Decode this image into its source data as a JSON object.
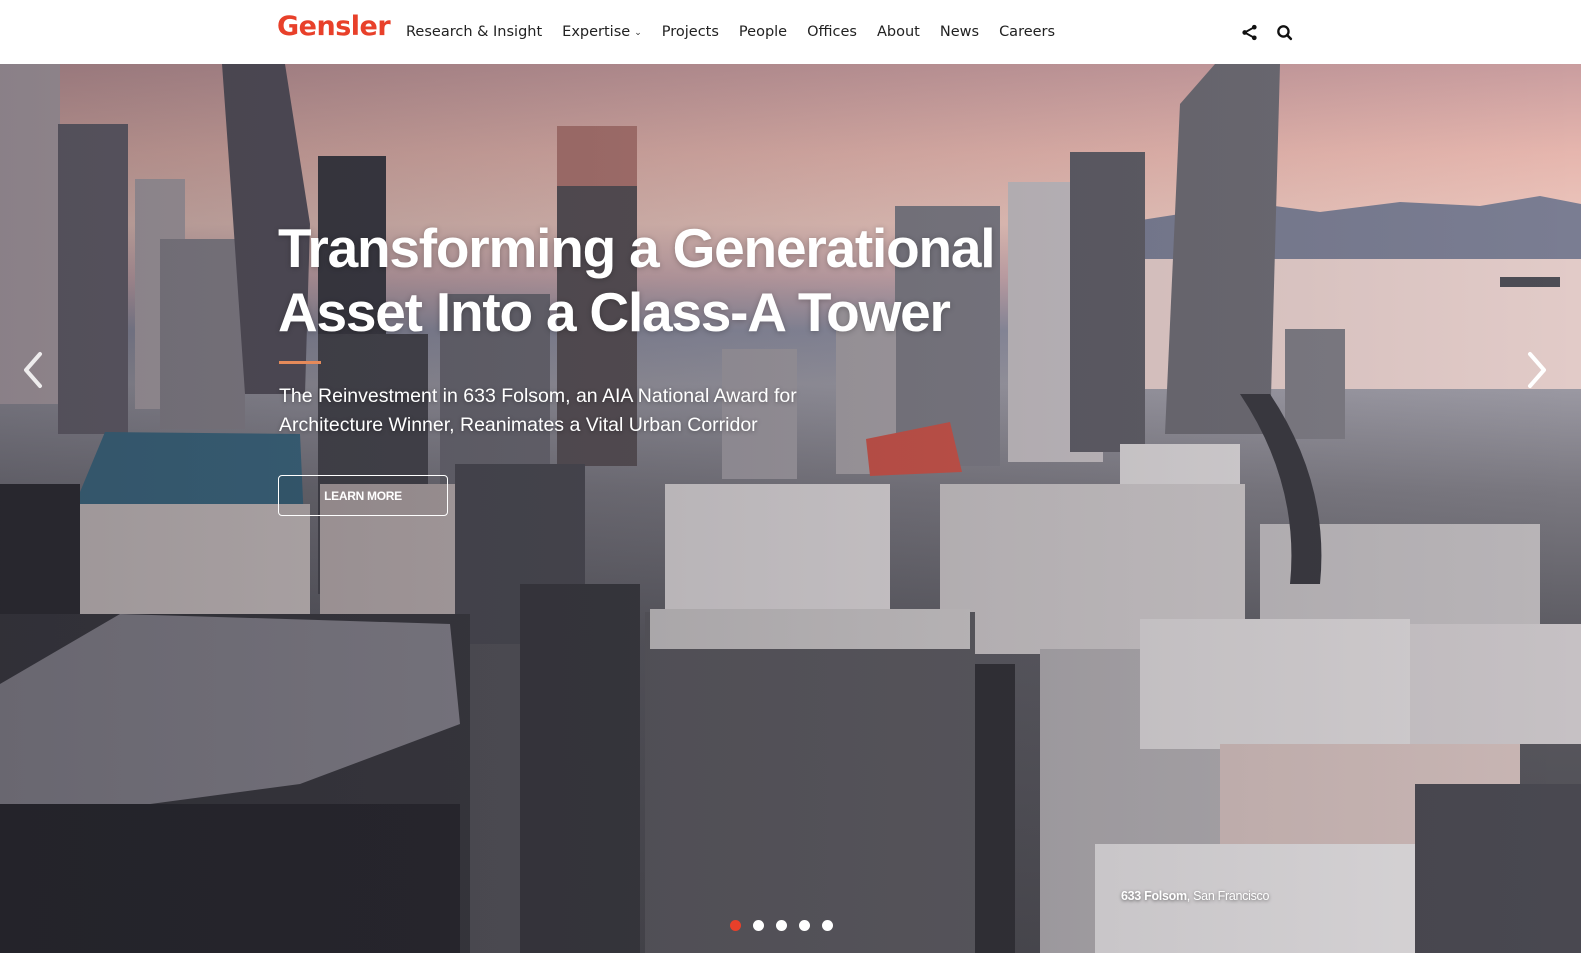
{
  "header": {
    "logo": "Gensler",
    "nav": [
      {
        "label": "Research & Insight",
        "has_dropdown": false
      },
      {
        "label": "Expertise",
        "has_dropdown": true
      },
      {
        "label": "Projects",
        "has_dropdown": false
      },
      {
        "label": "People",
        "has_dropdown": false
      },
      {
        "label": "Offices",
        "has_dropdown": false
      },
      {
        "label": "About",
        "has_dropdown": false
      },
      {
        "label": "News",
        "has_dropdown": false
      },
      {
        "label": "Careers",
        "has_dropdown": false
      }
    ],
    "icons": [
      "share-icon",
      "search-icon"
    ]
  },
  "hero": {
    "title_line1": "Transforming a Generational",
    "title_line2": "Asset Into a Class-A Tower",
    "subtitle": "The Reinvestment in 633 Folsom, an AIA National Award for Architecture Winner, Reanimates a Vital Urban Corridor",
    "cta_label": "LEARN MORE",
    "caption_project": "633 Folsom",
    "caption_location": ", San Francisco",
    "slides_total": 5,
    "active_slide": 1,
    "prev_icon": "chevron-left-icon",
    "next_icon": "chevron-right-icon"
  },
  "colors": {
    "brand": "#e8402a",
    "accent_rule": "#e58a5a",
    "text": "#222222"
  }
}
